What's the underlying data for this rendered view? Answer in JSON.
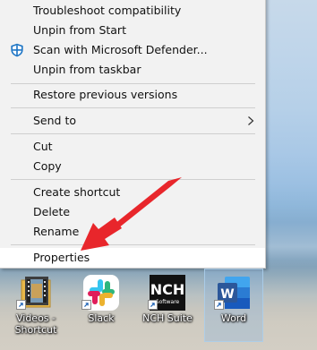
{
  "context_menu": {
    "items": [
      {
        "label": "Troubleshoot compatibility"
      },
      {
        "label": "Unpin from Start"
      },
      {
        "label": "Scan with Microsoft Defender..."
      },
      {
        "label": "Unpin from taskbar"
      },
      {
        "label": "Restore previous versions"
      },
      {
        "label": "Send to"
      },
      {
        "label": "Cut"
      },
      {
        "label": "Copy"
      },
      {
        "label": "Create shortcut"
      },
      {
        "label": "Delete"
      },
      {
        "label": "Rename"
      },
      {
        "label": "Properties"
      }
    ]
  },
  "desktop_icons": [
    {
      "label": "Videos - Shortcut"
    },
    {
      "label": "Slack"
    },
    {
      "label": "NCH Suite",
      "logo_text": "NCH",
      "logo_subtext": "Software"
    },
    {
      "label": "Word",
      "logo_text": "W"
    }
  ],
  "colors": {
    "arrow": "#e8262b",
    "word_blue": "#2b579a",
    "menu_bg": "#f2f2f2"
  },
  "icons": [
    "shield-icon",
    "chevron-right-icon",
    "shortcut-arrow-icon",
    "red-pointer-arrow"
  ]
}
